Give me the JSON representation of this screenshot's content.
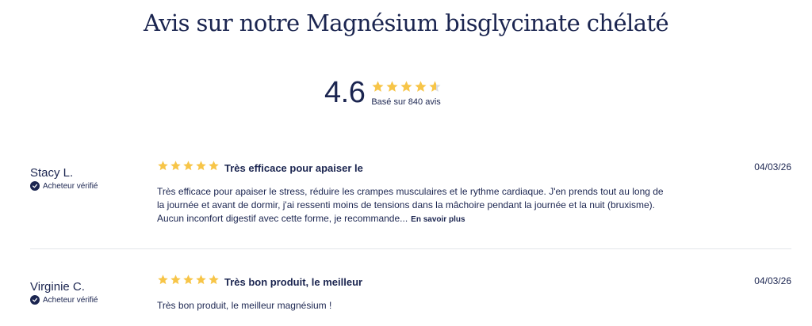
{
  "page": {
    "title": "Avis sur notre Magnésium bisglycinate chélaté"
  },
  "summary": {
    "average": "4.6",
    "rating_value": 4.6,
    "max_rating": 5,
    "count_text": "Basé sur 840 avis",
    "star_color": "#f7c548"
  },
  "reviews": [
    {
      "name": "Stacy L.",
      "verified_label": "Acheteur vérifié",
      "rating": 5,
      "title": "Très efficace pour apaiser le",
      "date": "04/03/26",
      "body": "Très efficace pour apaiser le stress, réduire les crampes musculaires et le rythme cardiaque. J'en prends tout au long de la journée et avant de dormir, j'ai ressenti moins de tensions dans la mâchoire pendant la journée et la nuit (bruxisme). Aucun inconfort digestif avec cette forme, je recommande...",
      "read_more": "En savoir plus"
    },
    {
      "name": "Virginie C.",
      "verified_label": "Acheteur vérifié",
      "rating": 5,
      "title": "Très bon produit, le meilleur",
      "date": "04/03/26",
      "body": "Très bon produit, le meilleur magnésium !"
    }
  ],
  "colors": {
    "text": "#1b2550",
    "star": "#f7c548",
    "star_empty": "#d9dbe1",
    "divider": "#e3e5ea"
  }
}
